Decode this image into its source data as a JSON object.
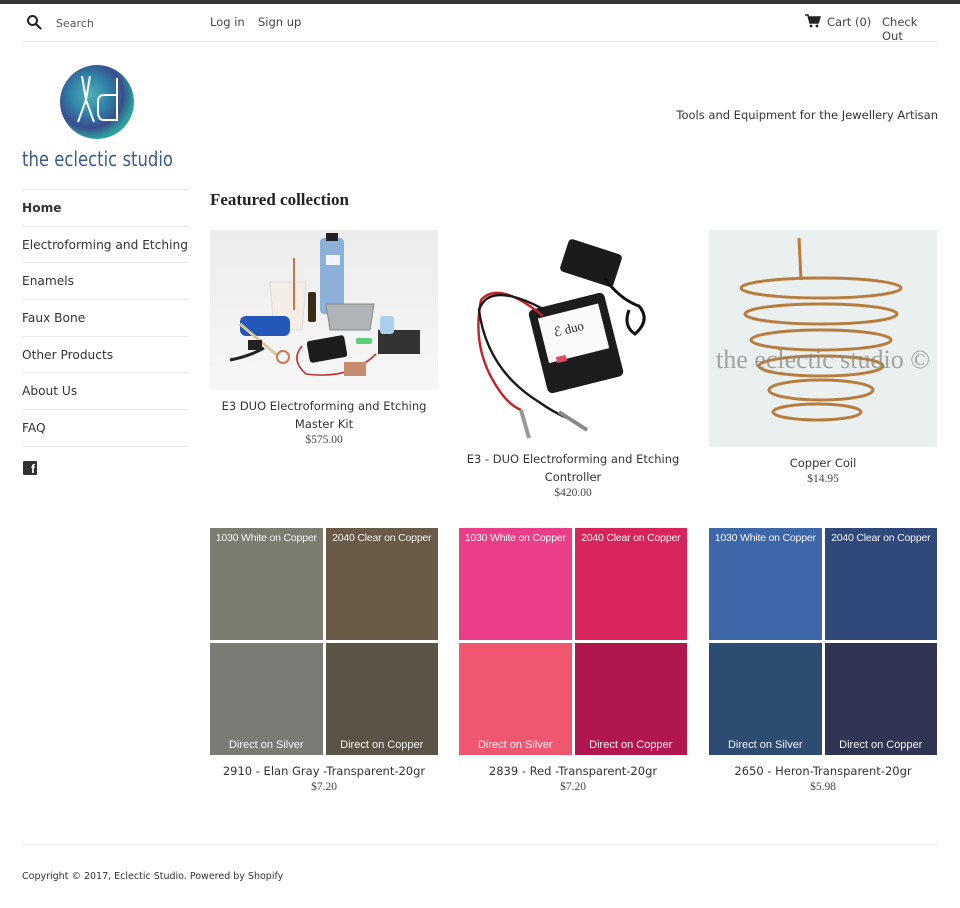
{
  "header": {
    "search_placeholder": "Search",
    "login_label": "Log in",
    "signup_label": "Sign up",
    "cart_label": "Cart (0)",
    "cart_count": 0,
    "checkout_label": "Check Out"
  },
  "brand": {
    "name": "the eclectic studio",
    "tagline": "Tools and Equipment for the Jewellery Artisan",
    "logo_text_color": "#3d5a8a"
  },
  "sidebar": {
    "items": [
      {
        "label": "Home",
        "active": true
      },
      {
        "label": "Electroforming and Etching",
        "active": false
      },
      {
        "label": "Enamels",
        "active": false
      },
      {
        "label": "Faux Bone",
        "active": false
      },
      {
        "label": "Other Products",
        "active": false
      },
      {
        "label": "About Us",
        "active": false
      },
      {
        "label": "FAQ",
        "active": false
      }
    ],
    "social": "facebook-icon"
  },
  "main": {
    "section_title": "Featured collection",
    "products": [
      {
        "title": "E3 DUO Electroforming and Etching Master Kit",
        "price": "$575.00"
      },
      {
        "title": "E3 - DUO Electroforming and Etching Controller",
        "price": "$420.00"
      },
      {
        "title": "Copper Coil",
        "price": "$14.95",
        "watermark": "the eclectic studio ©"
      },
      {
        "title": "2910 - Elan Gray -Transparent-20gr",
        "price": "$7.20",
        "swatches": [
          {
            "label": "1030 White on Copper",
            "color": "#7d7c71"
          },
          {
            "label": "2040 Clear on Copper",
            "color": "#6a5a48"
          },
          {
            "label": "Direct on Silver",
            "color": "#7a7b74"
          },
          {
            "label": "Direct on Copper",
            "color": "#5a5446"
          }
        ]
      },
      {
        "title": "2839 - Red -Transparent-20gr",
        "price": "$7.20",
        "swatches": [
          {
            "label": "1030 White on Copper",
            "color": "#ea3f88"
          },
          {
            "label": "2040 Clear on Copper",
            "color": "#d8245c"
          },
          {
            "label": "Direct on Silver",
            "color": "#f0566f"
          },
          {
            "label": "Direct on Copper",
            "color": "#b1164e"
          }
        ]
      },
      {
        "title": "2650 - Heron-Transparent-20gr",
        "price": "$5.98",
        "swatches": [
          {
            "label": "1030 White on Copper",
            "color": "#3e67a9"
          },
          {
            "label": "2040 Clear on Copper",
            "color": "#2f4a7a"
          },
          {
            "label": "Direct on Silver",
            "color": "#2d4c72"
          },
          {
            "label": "Direct on Copper",
            "color": "#2f3452"
          }
        ]
      }
    ]
  },
  "footer": {
    "copyright": "Copyright © 2017, Eclectic Studio. Powered by Shopify"
  }
}
